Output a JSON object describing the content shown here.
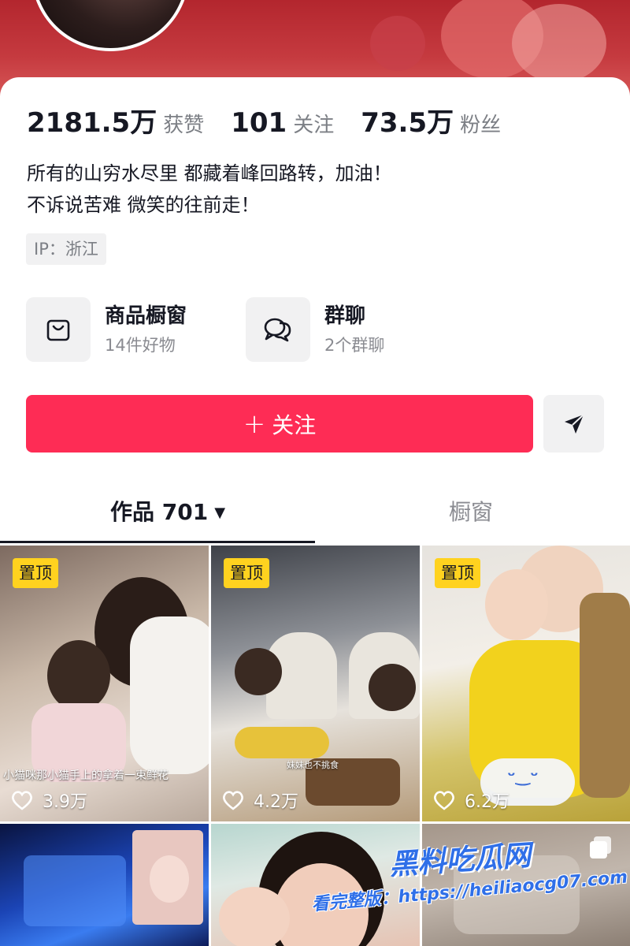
{
  "profile": {
    "stats": [
      {
        "value": "2181.5万",
        "label": "获赞"
      },
      {
        "value": "101",
        "label": "关注"
      },
      {
        "value": "73.5万",
        "label": "粉丝"
      }
    ],
    "bio_lines": [
      "所有的山穷水尽里 都藏着峰回路转，加油！",
      "不诉说苦难 微笑的往前走！"
    ],
    "ip": "IP：浙江"
  },
  "services": [
    {
      "title": "商品橱窗",
      "subtitle": "14件好物",
      "icon": "shopping-bag-icon"
    },
    {
      "title": "群聊",
      "subtitle": "2个群聊",
      "icon": "chat-bubbles-icon"
    }
  ],
  "actions": {
    "follow_plus": "+",
    "follow_label": "关注",
    "share_icon": "paper-plane-icon"
  },
  "tabs": [
    {
      "label": "作品 701",
      "active": true,
      "caret": "▼"
    },
    {
      "label": "橱窗",
      "active": false
    }
  ],
  "videos": [
    {
      "pinned": "置顶",
      "likes": "3.9万",
      "caption": "小猫咪那小猫手上的拿着一束鲜花"
    },
    {
      "pinned": "置顶",
      "likes": "4.2万",
      "caption": "妹妹也不挑食"
    },
    {
      "pinned": "置顶",
      "likes": "6.2万"
    },
    {},
    {},
    {
      "multi_icon": "multi-image-icon"
    }
  ],
  "watermark": {
    "brand": "黑料吃瓜网",
    "url": "看完整版：https://heiliaocg07.com"
  },
  "colors": {
    "accent": "#fe2c55",
    "banner": "#c53a3f",
    "pin": "#ffd21f",
    "text_secondary": "#7c7f85"
  }
}
